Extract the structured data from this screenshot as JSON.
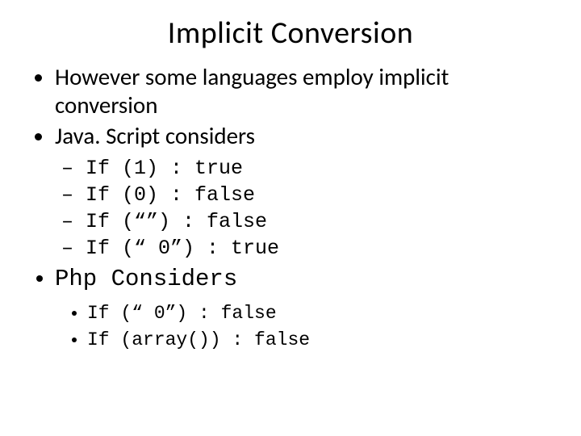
{
  "title": "Implicit Conversion",
  "bullets": {
    "b1": "However some languages employ implicit conversion",
    "b2": "Java. Script considers",
    "b3": "Php Considers"
  },
  "js_examples": {
    "e1": "If (1)  : true",
    "e2": "If (0)  : false",
    "e3": "If (“”) : false",
    "e4": "If (“ 0”) : true"
  },
  "php_examples": {
    "p1": "If (“ 0”) : false",
    "p2": "If (array()) : false"
  }
}
